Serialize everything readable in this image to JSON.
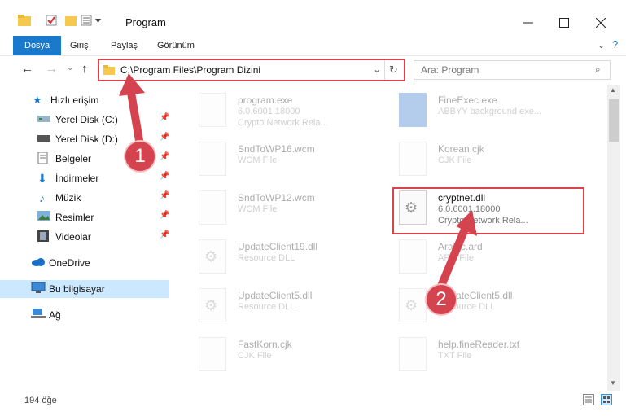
{
  "window": {
    "title": "Program"
  },
  "ribbon": {
    "tabs": [
      "Dosya",
      "Giriş",
      "Paylaş",
      "Görünüm"
    ]
  },
  "address": {
    "path": "C:\\Program Files\\Program Dizini"
  },
  "search": {
    "placeholder": "Ara: Program"
  },
  "sidebar": {
    "items": [
      {
        "label": "Hızlı erişim"
      },
      {
        "label": "Yerel Disk (C:)"
      },
      {
        "label": "Yerel Disk (D:)"
      },
      {
        "label": "Belgeler"
      },
      {
        "label": "İndirmeler"
      },
      {
        "label": "Müzik"
      },
      {
        "label": "Resimler"
      },
      {
        "label": "Videolar"
      },
      {
        "label": "OneDrive"
      },
      {
        "label": "Bu bilgisayar"
      },
      {
        "label": "Ağ"
      }
    ]
  },
  "files": [
    {
      "name": "program.exe",
      "line2": "6.0.6001.18000",
      "line3": "Crypto Network Rela..."
    },
    {
      "name": "FineExec.exe",
      "line2": "ABBYY background exe...",
      "line3": ""
    },
    {
      "name": "SndToWP16.wcm",
      "line2": "WCM File",
      "line3": ""
    },
    {
      "name": "Korean.cjk",
      "line2": "CJK File",
      "line3": ""
    },
    {
      "name": "SndToWP12.wcm",
      "line2": "WCM File",
      "line3": ""
    },
    {
      "name": "cryptnet.dll",
      "line2": "6.0.6001.18000",
      "line3": "Crypto Network Rela..."
    },
    {
      "name": "UpdateClient19.dll",
      "line2": "Resource DLL",
      "line3": ""
    },
    {
      "name": "Arabic.ard",
      "line2": "ARD File",
      "line3": ""
    },
    {
      "name": "UpdateClient5.dll",
      "line2": "Resource DLL",
      "line3": ""
    },
    {
      "name": "UpdateClient5.dll",
      "line2": "Resource DLL",
      "line3": ""
    },
    {
      "name": "FastKorn.cjk",
      "line2": "CJK File",
      "line3": ""
    },
    {
      "name": "help.fineReader.txt",
      "line2": "TXT File",
      "line3": ""
    }
  ],
  "status": {
    "count": "194 öğe"
  },
  "badges": {
    "one": "1",
    "two": "2"
  }
}
